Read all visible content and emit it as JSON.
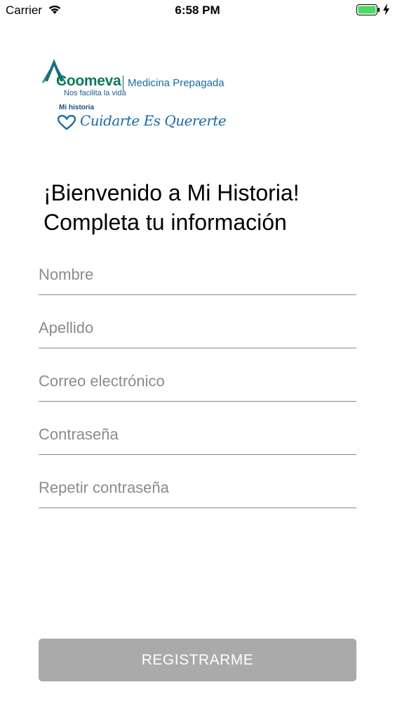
{
  "status_bar": {
    "carrier": "Carrier",
    "time": "6:58 PM",
    "battery_color": "#4cd964"
  },
  "logo": {
    "brand": "Coomeva",
    "product": "Medicina Prepagada",
    "tagline": "Nos facilita la vida",
    "sub": "Mi historia",
    "slogan": "Cuidarte Es Quererte",
    "brand_color": "#0d7a5a",
    "accent_color": "#1b6aa0"
  },
  "welcome": {
    "line1": "¡Bienvenido a Mi Historia!",
    "line2": "Completa tu información"
  },
  "form": {
    "name_placeholder": "Nombre",
    "surname_placeholder": "Apellido",
    "email_placeholder": "Correo electrónico",
    "password_placeholder": "Contraseña",
    "repeat_password_placeholder": "Repetir contraseña"
  },
  "register_button": {
    "label": "REGISTRARME",
    "color": "#aaaaaa"
  }
}
